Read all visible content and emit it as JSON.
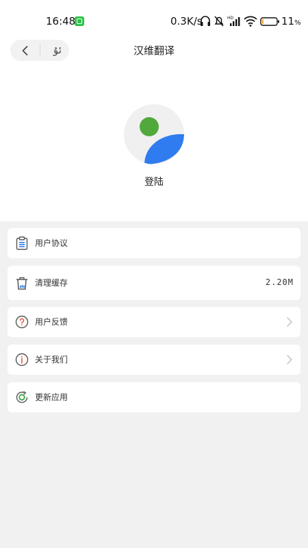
{
  "status_bar": {
    "time": "16:48",
    "net_speed": "0.3K/s",
    "battery_percent": "11",
    "battery_unit": "%",
    "battery_level": 0.11,
    "battery_color": "#f2a33a"
  },
  "header": {
    "title": "汉维翻译",
    "lang_toggle": "ئۇ"
  },
  "profile": {
    "login_label": "登陆",
    "avatar_colors": {
      "head": "#52a93b",
      "body": "#2f7cf0",
      "bg": "#f0f0f0"
    }
  },
  "menu": {
    "items": [
      {
        "label": "用户协议",
        "icon": "clipboard-icon"
      },
      {
        "label": "清理缓存",
        "icon": "trash-icon",
        "value": "2.20M"
      },
      {
        "label": "用户反馈",
        "icon": "question-icon",
        "chevron": true
      },
      {
        "label": "关于我们",
        "icon": "info-icon",
        "chevron": true
      },
      {
        "label": "更新应用",
        "icon": "update-icon"
      }
    ]
  }
}
